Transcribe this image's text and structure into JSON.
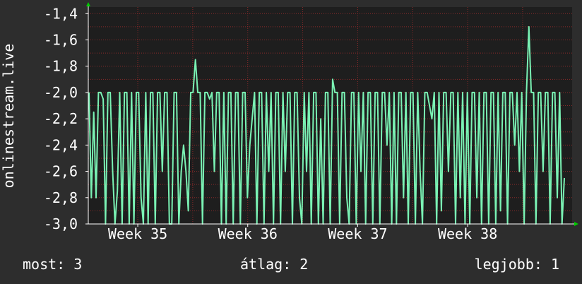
{
  "chart_data": {
    "type": "line",
    "ylabel": "onlinestream.live",
    "ylim": [
      -3.0,
      -1.35
    ],
    "yticks": [
      "-1,4",
      "-1,6",
      "-1,8",
      "-2,0",
      "-2,2",
      "-2,4",
      "-2,6",
      "-2,8",
      "-3,0"
    ],
    "ytick_values": [
      -1.4,
      -1.6,
      -1.8,
      -2.0,
      -2.2,
      -2.4,
      -2.6,
      -2.8,
      -3.0
    ],
    "xlim": [
      34.55,
      38.95
    ],
    "xticks": [
      "Week 35",
      "Week 36",
      "Week 37",
      "Week 38"
    ],
    "xtick_values": [
      35,
      36,
      37,
      38
    ],
    "grid": true,
    "colors": {
      "background": "#2d2d2d",
      "plot_area": "#1e1e1e",
      "grid": "#8a2a2a",
      "line": "#7af2b4",
      "axis": "#ffffff",
      "arrow": "#00cc00"
    },
    "series": [
      {
        "values": [
          -2.0,
          -2.8,
          -2.15,
          -2.8,
          -2.0,
          -2.0,
          -2.05,
          -3.0,
          -2.0,
          -2.0,
          -2.6,
          -3.0,
          -2.75,
          -2.0,
          -3.0,
          -2.0,
          -2.0,
          -3.0,
          -2.0,
          -3.0,
          -2.0,
          -2.0,
          -2.8,
          -3.0,
          -2.0,
          -3.0,
          -2.0,
          -2.0,
          -3.0,
          -2.0,
          -2.0,
          -2.6,
          -2.0,
          -2.0,
          -3.0,
          -3.0,
          -2.0,
          -2.0,
          -3.0,
          -2.6,
          -2.4,
          -2.6,
          -2.9,
          -2.0,
          -2.0,
          -1.75,
          -2.0,
          -2.0,
          -3.0,
          -2.0,
          -2.0,
          -2.05,
          -2.0,
          -2.6,
          -2.0,
          -2.0,
          -3.0,
          -2.0,
          -3.0,
          -2.0,
          -2.0,
          -3.0,
          -2.0,
          -2.0,
          -3.0,
          -2.0,
          -2.0,
          -2.8,
          -2.4,
          -2.2,
          -2.0,
          -3.0,
          -2.0,
          -2.0,
          -3.0,
          -2.0,
          -2.6,
          -2.0,
          -3.0,
          -2.0,
          -2.0,
          -3.0,
          -2.0,
          -2.6,
          -2.0,
          -2.0,
          -3.0,
          -2.0,
          -2.0,
          -2.8,
          -3.0,
          -2.0,
          -2.6,
          -2.0,
          -3.0,
          -2.0,
          -2.0,
          -3.0,
          -2.2,
          -3.0,
          -2.0,
          -2.0,
          -3.0,
          -1.9,
          -2.0,
          -2.0,
          -3.0,
          -2.0,
          -2.0,
          -2.8,
          -3.0,
          -2.0,
          -2.0,
          -3.0,
          -2.0,
          -2.6,
          -2.0,
          -3.0,
          -2.0,
          -2.0,
          -3.0,
          -2.0,
          -2.0,
          -3.0,
          -2.0,
          -2.0,
          -2.4,
          -2.0,
          -3.0,
          -2.0,
          -3.0,
          -2.0,
          -2.0,
          -2.8,
          -2.0,
          -3.0,
          -2.0,
          -2.0,
          -3.0,
          -2.0,
          -2.6,
          -3.0,
          -2.0,
          -2.0,
          -2.1,
          -2.2,
          -2.0,
          -3.0,
          -2.0,
          -2.9,
          -2.0,
          -2.0,
          -2.6,
          -2.0,
          -2.0,
          -3.0,
          -2.0,
          -2.8,
          -2.0,
          -3.0,
          -2.0,
          -3.0,
          -2.0,
          -2.0,
          -2.8,
          -2.0,
          -3.0,
          -2.0,
          -2.0,
          -3.0,
          -2.0,
          -2.0,
          -3.0,
          -2.0,
          -2.9,
          -2.0,
          -2.0,
          -3.0,
          -2.0,
          -2.0,
          -2.4,
          -2.0,
          -2.6,
          -2.0,
          -3.0,
          -2.0,
          -1.5,
          -2.0,
          -2.0,
          -3.0,
          -2.0,
          -2.0,
          -2.6,
          -2.0,
          -2.0,
          -3.0,
          -2.0,
          -2.0,
          -2.8,
          -2.0,
          -3.0,
          -2.65
        ]
      }
    ]
  },
  "footer": {
    "current": "most: 3",
    "average": "átlag: 2",
    "best": "legjobb: 1"
  }
}
